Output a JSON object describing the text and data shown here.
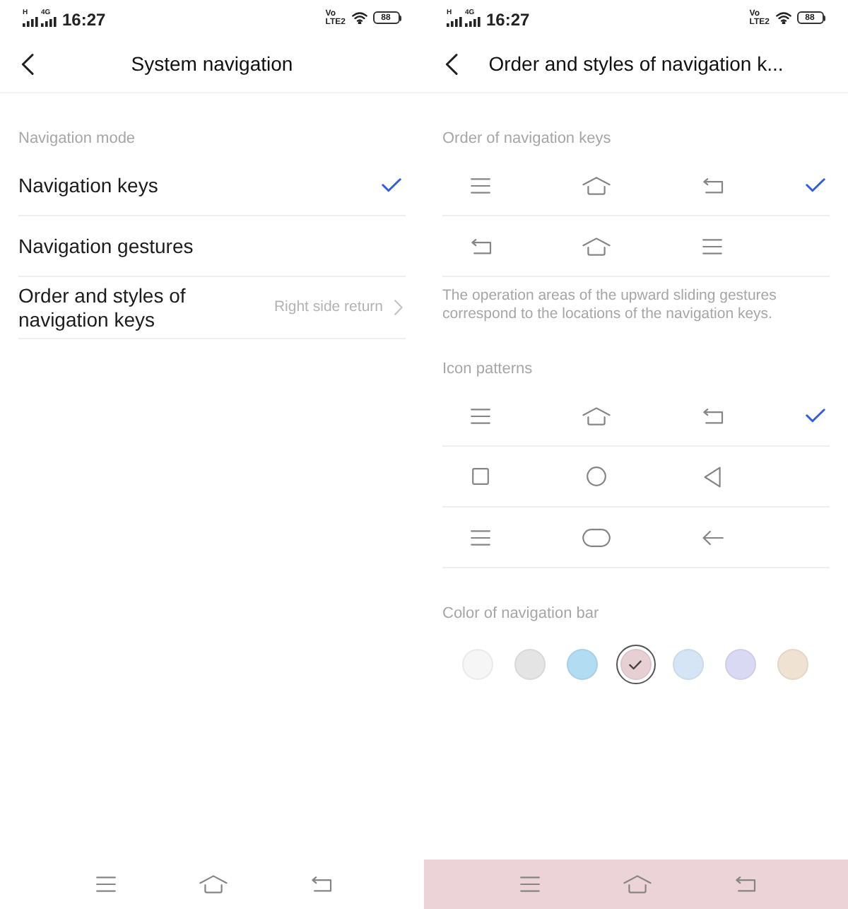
{
  "screens": [
    {
      "status_bar": {
        "network_labels": [
          "H",
          "4G"
        ],
        "time": "16:27",
        "volte_labels": [
          "Vo",
          "LTE2"
        ],
        "battery": "88"
      },
      "header": {
        "title": "System navigation"
      },
      "sections": [
        {
          "label": "Navigation mode",
          "items": [
            {
              "kind": "option",
              "label": "Navigation keys",
              "selected": true
            },
            {
              "kind": "option",
              "label": "Navigation gestures",
              "selected": false
            },
            {
              "kind": "link",
              "label": "Order and styles of navigation keys",
              "value": "Right side return"
            }
          ]
        }
      ],
      "nav_bar": {
        "keys": [
          {
            "kind": "menu"
          },
          {
            "kind": "home"
          },
          {
            "kind": "back"
          }
        ]
      }
    },
    {
      "status_bar": {
        "network_labels": [
          "H",
          "4G"
        ],
        "time": "16:27",
        "volte_labels": [
          "Vo",
          "LTE2"
        ],
        "battery": "88"
      },
      "header": {
        "title": "Order and styles of navigation k..."
      },
      "sections": [
        {
          "label": "Order of navigation keys",
          "items": [
            {
              "kind": "keys",
              "selected": true,
              "keys": [
                {
                  "kind": "menu"
                },
                {
                  "kind": "home"
                },
                {
                  "kind": "back"
                }
              ]
            },
            {
              "kind": "keys",
              "selected": false,
              "keys": [
                {
                  "kind": "back"
                },
                {
                  "kind": "home"
                },
                {
                  "kind": "menu"
                }
              ]
            }
          ],
          "note": "The operation areas of the upward sliding gestures correspond to the locations of the navigation keys."
        },
        {
          "label": "Icon patterns",
          "items": [
            {
              "kind": "keys",
              "selected": true,
              "keys": [
                {
                  "kind": "menu"
                },
                {
                  "kind": "home"
                },
                {
                  "kind": "back"
                }
              ]
            },
            {
              "kind": "keys",
              "selected": false,
              "keys": [
                {
                  "kind": "square"
                },
                {
                  "kind": "circle"
                },
                {
                  "kind": "triangle"
                }
              ]
            },
            {
              "kind": "keys",
              "selected": false,
              "keys": [
                {
                  "kind": "menu"
                },
                {
                  "kind": "pill"
                },
                {
                  "kind": "arrow"
                }
              ]
            }
          ]
        },
        {
          "label": "Color of navigation bar",
          "swatches": [
            {
              "color": "#f6f6f6",
              "selected": false
            },
            {
              "color": "#e4e4e4",
              "selected": false
            },
            {
              "color": "#b2dcf1",
              "selected": false
            },
            {
              "color": "#e8cfd4",
              "selected": true
            },
            {
              "color": "#d6e5f5",
              "selected": false
            },
            {
              "color": "#d9d9f3",
              "selected": false
            },
            {
              "color": "#efe2d3",
              "selected": false
            }
          ]
        }
      ],
      "nav_bar": {
        "color": "#ebd3d7",
        "keys": [
          {
            "kind": "menu"
          },
          {
            "kind": "home"
          },
          {
            "kind": "back"
          }
        ]
      }
    }
  ]
}
